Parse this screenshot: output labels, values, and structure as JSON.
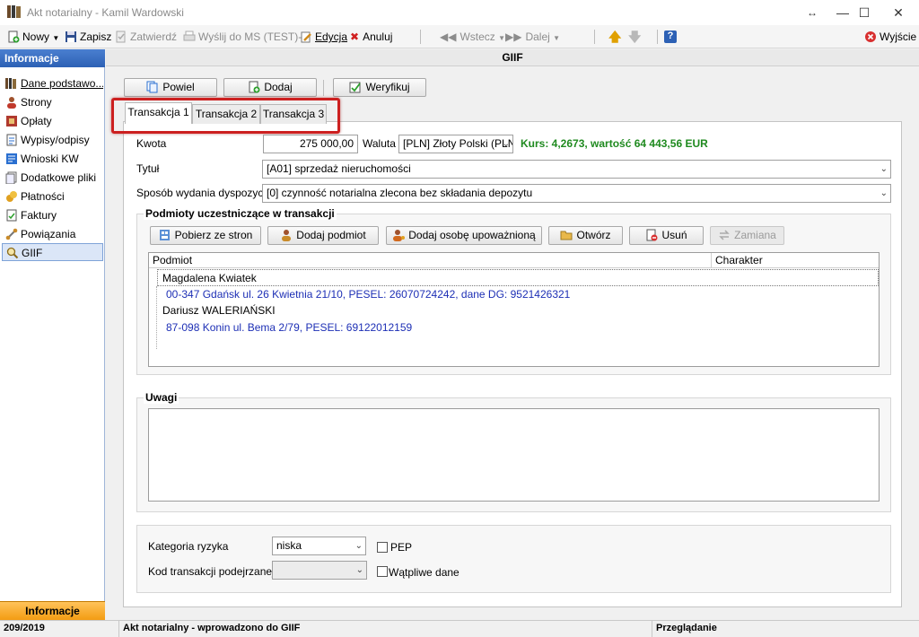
{
  "window": {
    "title": "Akt notarialny - Kamil Wardowski"
  },
  "toolbar": {
    "new_label": "Nowy",
    "save_label": "Zapisz",
    "approve_label": "Zatwierdź",
    "send_label": "Wyślij do MS (TEST)-",
    "edit_label": "Edycja",
    "cancel_label": "Anuluj",
    "back_label": "Wstecz",
    "next_label": "Dalej",
    "help_label": "?",
    "exit_label": "Wyjście"
  },
  "sidebar": {
    "header": "Informacje",
    "items": [
      {
        "label": "Dane podstawo..."
      },
      {
        "label": "Strony"
      },
      {
        "label": "Opłaty"
      },
      {
        "label": "Wypisy/odpisy"
      },
      {
        "label": "Wnioski KW"
      },
      {
        "label": "Dodatkowe pliki"
      },
      {
        "label": "Płatności"
      },
      {
        "label": "Faktury"
      },
      {
        "label": "Powiązania"
      },
      {
        "label": "GIIF"
      }
    ],
    "footer": "Informacje"
  },
  "main": {
    "title": "GIIF",
    "buttons": {
      "duplicate": "Powiel",
      "add": "Dodaj",
      "verify": "Weryfikuj"
    },
    "tabs": [
      {
        "label": "Transakcja 1"
      },
      {
        "label": "Transakcja 2"
      },
      {
        "label": "Transakcja 3"
      }
    ],
    "form": {
      "amount_label": "Kwota",
      "amount_value": "275 000,00",
      "currency_label": "Waluta",
      "currency_value": "[PLN] Złoty Polski (PLN",
      "rate_text": "Kurs: 4,2673, wartość 64 443,56 EUR",
      "title_label": "Tytuł",
      "title_value": "[A01] sprzedaż nieruchomości",
      "disposition_label": "Sposób wydania dyspozycji",
      "disposition_value": "[0] czynność notarialna zlecona bez składania depozytu"
    },
    "participants": {
      "group_title": "Podmioty uczestniczące w transakcji",
      "buttons": {
        "fetch": "Pobierz ze stron",
        "add_entity": "Dodaj podmiot",
        "add_authorized": "Dodaj osobę upoważnioną",
        "open": "Otwórz",
        "remove": "Usuń",
        "replace": "Zamiana"
      },
      "columns": [
        "Podmiot",
        "Charakter"
      ],
      "rows": [
        {
          "name": "Magdalena Kwiatek",
          "detail": "00-347 Gdańsk ul. 26 Kwietnia 21/10, PESEL: 26070724242, dane DG: 9521426321"
        },
        {
          "name": "Dariusz WALERIAŃSKI",
          "detail": "87-098 Konin ul. Bema 2/79, PESEL: 69122012159"
        }
      ]
    },
    "notes": {
      "group_title": "Uwagi",
      "value": ""
    },
    "risk": {
      "category_label": "Kategoria ryzyka",
      "category_value": "niska",
      "pep_label": "PEP",
      "suspicious_code_label": "Kod transakcji podejrzanej",
      "suspicious_code_value": "",
      "doubtful_label": "Wątpliwe dane"
    }
  },
  "statusbar": {
    "number": "209/2019",
    "message": "Akt notarialny - wprowadzono do GIIF",
    "mode": "Przeglądanie"
  },
  "colors": {
    "accent_blue": "#2d61b5",
    "rate_green": "#1f8a1f",
    "detail_blue": "#1d2fb5",
    "highlight_red": "#cc2020",
    "footer_orange": "#f39c12"
  }
}
